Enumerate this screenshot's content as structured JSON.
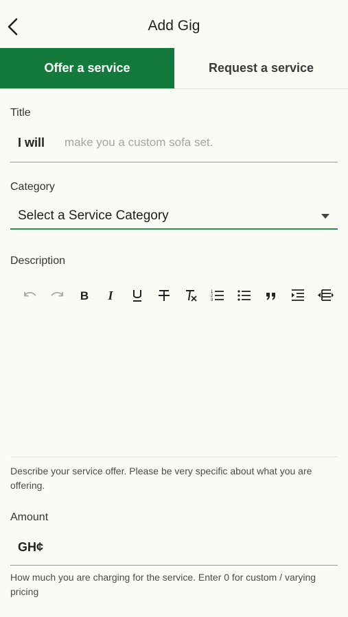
{
  "header": {
    "title": "Add Gig"
  },
  "tabs": [
    {
      "label": "Offer a service",
      "active": true
    },
    {
      "label": "Request a service",
      "active": false
    }
  ],
  "colors": {
    "accent": "#137a3c",
    "underline_active": "#2e8a52",
    "background": "#fbfbf6"
  },
  "title_field": {
    "label": "Title",
    "prefix": "I will",
    "placeholder": "make you a custom sofa set.",
    "value": ""
  },
  "category": {
    "label": "Category",
    "selected": "Select a Service Category"
  },
  "description": {
    "label": "Description",
    "toolbar": [
      "undo-icon",
      "redo-icon",
      "bold-icon",
      "italic-icon",
      "underline-icon",
      "strikethrough-icon",
      "clear-format-icon",
      "numbered-list-icon",
      "bullet-list-icon",
      "quote-icon",
      "indent-icon",
      "outdent-icon"
    ],
    "helper": "Describe your service offer. Please be very specific about what you are offering."
  },
  "amount": {
    "label": "Amount",
    "currency": "GH¢",
    "value": "",
    "helper": "How much you are charging for the service. Enter 0 for custom / varying pricing"
  }
}
